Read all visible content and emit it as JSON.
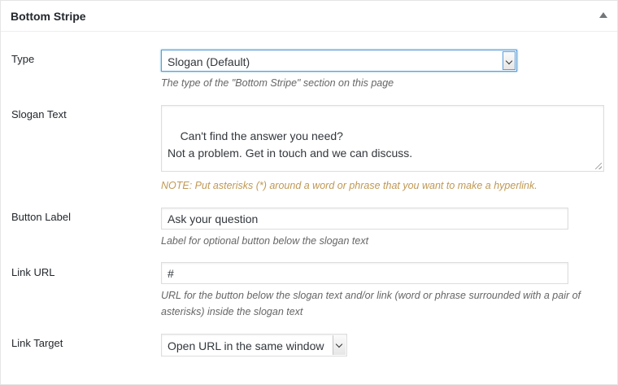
{
  "metabox": {
    "title": "Bottom Stripe",
    "toggle_icon": "triangle-up-icon"
  },
  "fields": {
    "type": {
      "label": "Type",
      "selected": "Slogan (Default)",
      "description": "The type of the \"Bottom Stripe\" section on this page"
    },
    "slogan_text": {
      "label": "Slogan Text",
      "value": "Can't find the answer you need?\nNot a problem. Get in touch and we can discuss.",
      "note": "NOTE: Put asterisks (*) around a word or phrase that you want to make a hyperlink."
    },
    "button_label": {
      "label": "Button Label",
      "value": "Ask your question",
      "description": "Label for optional button below the slogan text"
    },
    "link_url": {
      "label": "Link URL",
      "value": "#",
      "description_line1": "URL for the button below the slogan text and/or link (word or phrase surrounded with a pair of",
      "description_line2": "asterisks) inside the slogan text"
    },
    "link_target": {
      "label": "Link Target",
      "selected": "Open URL in the same window"
    }
  },
  "colors": {
    "note": "#c09853",
    "focus": "#5b9dd9"
  }
}
